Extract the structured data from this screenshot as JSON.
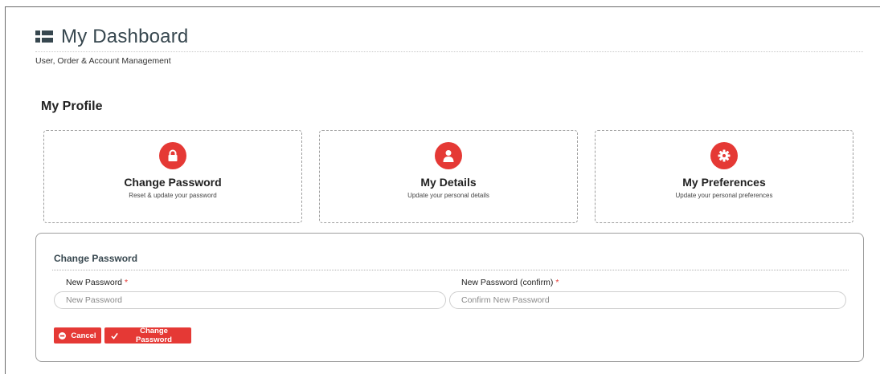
{
  "header": {
    "title": "My Dashboard",
    "subtitle": "User, Order & Account Management",
    "icon": "grid-list-icon"
  },
  "section": {
    "title": "My Profile"
  },
  "cards": [
    {
      "title": "Change Password",
      "description": "Reset & update your password",
      "icon": "lock-icon"
    },
    {
      "title": "My Details",
      "description": "Update your personal details",
      "icon": "user-icon"
    },
    {
      "title": "My Preferences",
      "description": "Update your personal preferences",
      "icon": "gear-icon"
    }
  ],
  "form": {
    "title": "Change Password",
    "new_password": {
      "label": "New Password",
      "required": "*",
      "placeholder": "New Password",
      "value": ""
    },
    "confirm_password": {
      "label": "New Password (confirm)",
      "required": "*",
      "placeholder": "Confirm New Password",
      "value": ""
    },
    "cancel_label": "Cancel",
    "submit_label": "Change Password"
  },
  "colors": {
    "accent": "#e53935",
    "heading": "#37474f",
    "border": "#9e9e9e"
  }
}
